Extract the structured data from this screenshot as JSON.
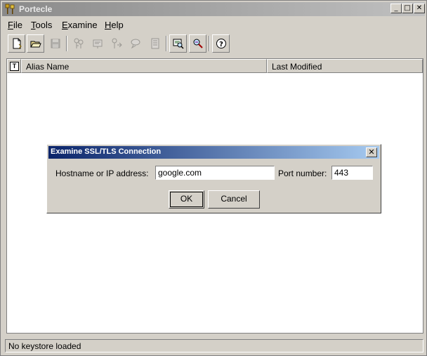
{
  "window": {
    "title": "Portecle",
    "icon": "keys-icon",
    "controls": {
      "minimize": "_",
      "maximize": "□",
      "close": "✕"
    }
  },
  "menu": [
    {
      "label": "File",
      "underline": "F"
    },
    {
      "label": "Tools",
      "underline": "T"
    },
    {
      "label": "Examine",
      "underline": "E"
    },
    {
      "label": "Help",
      "underline": "H"
    }
  ],
  "toolbar": [
    {
      "name": "new-keystore-icon",
      "enabled": true
    },
    {
      "name": "open-keystore-icon",
      "enabled": true
    },
    {
      "name": "save-keystore-icon",
      "enabled": false
    },
    {
      "name": "generate-keypair-icon",
      "enabled": false
    },
    {
      "name": "import-certificate-icon",
      "enabled": false
    },
    {
      "name": "import-keypair-icon",
      "enabled": false
    },
    {
      "name": "keystore-properties-icon",
      "enabled": false
    },
    {
      "name": "keystore-report-icon",
      "enabled": false
    },
    {
      "name": "examine-certificate-icon",
      "enabled": true
    },
    {
      "name": "examine-ssl-icon",
      "enabled": true
    },
    {
      "name": "help-icon",
      "enabled": true
    }
  ],
  "table": {
    "type_column_badge": "T",
    "columns": [
      "Alias Name",
      "Last Modified"
    ],
    "rows": []
  },
  "status": "No keystore loaded",
  "dialog": {
    "title": "Examine SSL/TLS Connection",
    "close_glyph": "✕",
    "hostname_label": "Hostname or IP address:",
    "hostname_value": "google.com",
    "port_label": "Port number:",
    "port_value": "443",
    "ok_label": "OK",
    "cancel_label": "Cancel"
  },
  "colors": {
    "dialog_title_start": "#0a246a",
    "dialog_title_end": "#a6caf0",
    "inactive_title_start": "#8a8a8a"
  }
}
